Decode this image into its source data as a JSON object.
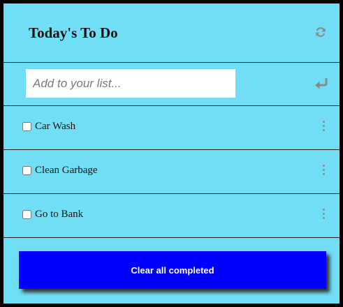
{
  "header": {
    "title": "Today's To Do",
    "refresh_icon": "refresh-icon"
  },
  "add": {
    "placeholder": "Add to your list...",
    "value": "",
    "enter_icon": "enter-icon"
  },
  "items": [
    {
      "label": "Car Wash",
      "checked": false
    },
    {
      "label": "Clean Garbage",
      "checked": false
    },
    {
      "label": "Go to Bank",
      "checked": false
    }
  ],
  "footer": {
    "clear_label": "Clear all completed"
  },
  "colors": {
    "background": "#70dff5",
    "frame": "#000000",
    "button": "#0000ff",
    "button_text": "#ffffff",
    "icon": "#8a8a8a"
  }
}
